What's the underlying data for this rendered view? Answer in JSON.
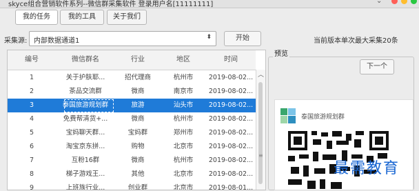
{
  "window": {
    "title": "skyce组合营销软件系列--微信群采集软件 登录用户名[11111111]",
    "controls": [
      "minimize-icon",
      "close-dot",
      "minimize-dot",
      "maximize-dot"
    ],
    "colors": {
      "close": "#ff5f57",
      "minimize": "#ffbd2e",
      "maximize": "#28c840"
    }
  },
  "tabs": [
    {
      "label": "我的任务"
    },
    {
      "label": "我的工具"
    },
    {
      "label": "关于我们"
    }
  ],
  "source": {
    "label": "采集源:",
    "selected": "内部数据通道1"
  },
  "start_label": "开始",
  "limit_note": "当前版本单次最大采集20条",
  "table": {
    "columns": [
      "编号",
      "微信群名",
      "行业",
      "地区",
      "时间"
    ],
    "rows": [
      [
        "1",
        "关于护肤耶...",
        "招代理商",
        "杭州市",
        "2019-08-02..."
      ],
      [
        "2",
        "茶品交流群",
        "微商",
        "南京市",
        "2019-08-02..."
      ],
      [
        "3",
        "泰国旅游规划群",
        "旅游",
        "汕头市",
        "2019-08-02..."
      ],
      [
        "4",
        "免费帮清货+...",
        "微商",
        "杭州市",
        "2019-08-02..."
      ],
      [
        "5",
        "宝妈聊天群...",
        "宝妈群",
        "郑州市",
        "2019-08-02..."
      ],
      [
        "6",
        "淘宝京东拼...",
        "购物",
        "北京市",
        "2019-08-02..."
      ],
      [
        "7",
        "互粉16群",
        "微商",
        "杭州市",
        "2019-08-02..."
      ],
      [
        "8",
        "梯子游戏王...",
        "其他",
        "北京市",
        "2019-08-02..."
      ],
      [
        "9",
        "上班族行业...",
        "创业群",
        "北京市",
        "2019-08-01..."
      ]
    ],
    "selected_index": 2,
    "selected_color": "#1f7bd8"
  },
  "preview": {
    "label": "预览",
    "next_label": "下一个",
    "card_title": "泰国旅游规划群"
  },
  "watermark": "最需教育"
}
